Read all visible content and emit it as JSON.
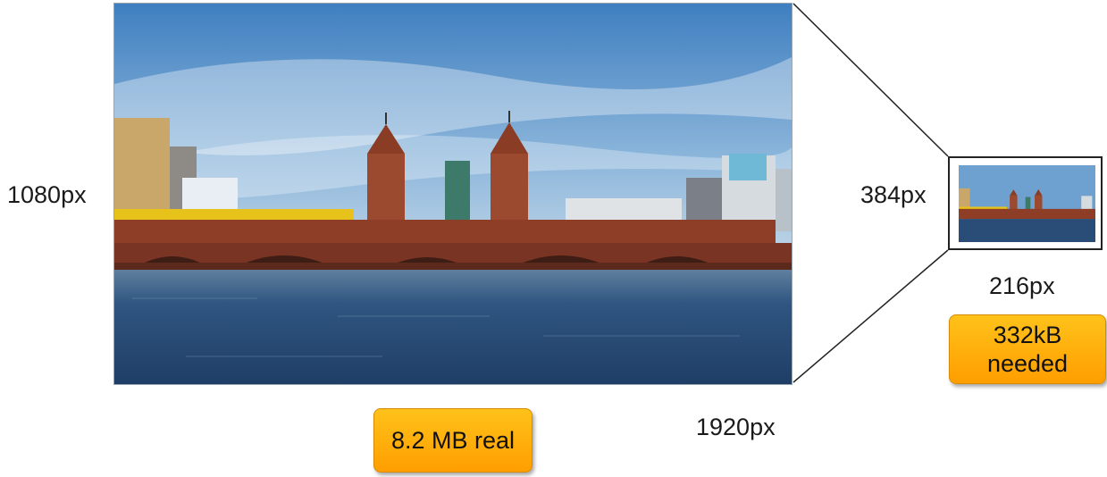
{
  "original": {
    "width_label": "1920px",
    "height_label": "1080px",
    "size_badge": "8.2 MB real"
  },
  "thumbnail": {
    "width_label": "384px",
    "height_label": "216px",
    "size_badge_line1": "332kB",
    "size_badge_line2": "needed"
  },
  "colors": {
    "badge_top": "#ffc21a",
    "badge_bottom": "#ff9e00",
    "sky": "#5b94c9",
    "water": "#2a4d78",
    "brick": "#8e3d27",
    "train": "#e6c21a"
  },
  "icons": {
    "photo": "bridge-photo-image",
    "thumbnail": "bridge-thumbnail-image"
  }
}
